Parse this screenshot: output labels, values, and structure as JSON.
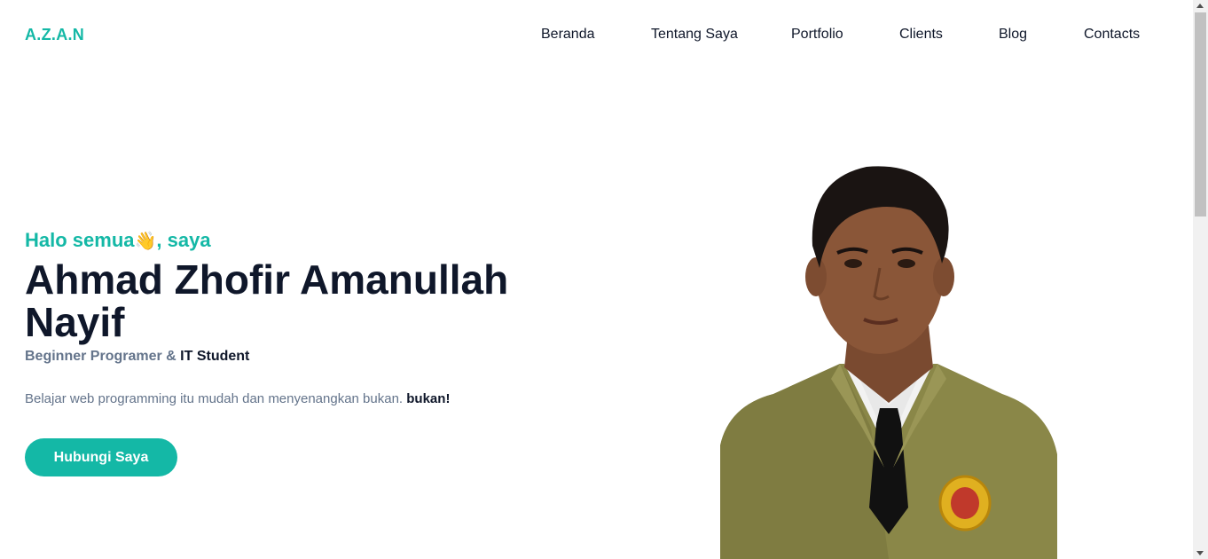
{
  "header": {
    "brand": "A.Z.A.N",
    "nav": [
      {
        "label": "Beranda"
      },
      {
        "label": "Tentang Saya"
      },
      {
        "label": "Portfolio"
      },
      {
        "label": "Clients"
      },
      {
        "label": "Blog"
      },
      {
        "label": "Contacts"
      }
    ]
  },
  "hero": {
    "greeting_prefix": "Halo semua",
    "greeting_emoji": "👋",
    "greeting_suffix": ", saya",
    "name": "Ahmad Zhofir Amanullah Nayif",
    "role_prefix": "Beginner Programer & ",
    "role_strong": "IT Student",
    "tagline_text": "Belajar web programming itu mudah dan menyenangkan bukan. ",
    "tagline_strong": "bukan!",
    "cta_label": "Hubungi Saya"
  },
  "colors": {
    "accent": "#14b8a6",
    "heading": "#0f172a",
    "muted": "#64748b"
  }
}
